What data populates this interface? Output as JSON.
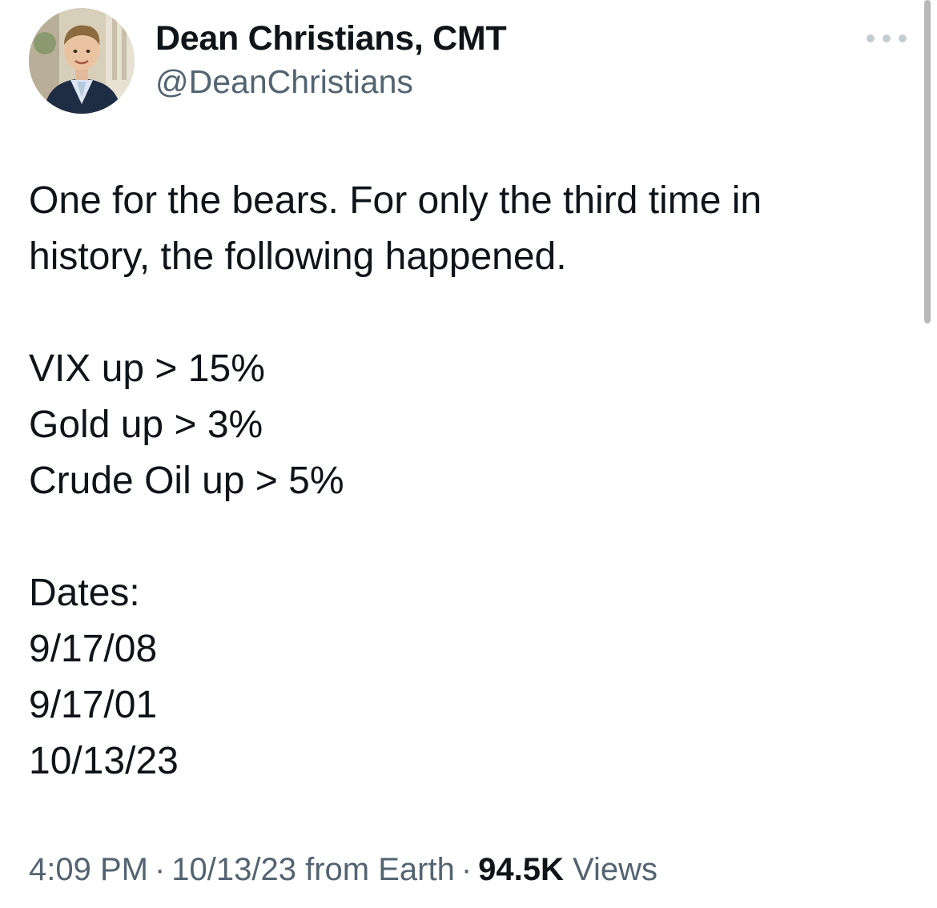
{
  "author": {
    "display_name": "Dean Christians, CMT",
    "handle": "@DeanChristians"
  },
  "more_menu": {
    "icon": "more-horizontal-icon"
  },
  "tweet": {
    "intro_lines": [
      "One for the bears. For only the third time in",
      "history, the following happened."
    ],
    "conditions": [
      "VIX up > 15%",
      "Gold up > 3%",
      "Crude Oil up > 5%"
    ],
    "dates_label": "Dates:",
    "dates": [
      "9/17/08",
      "9/17/01",
      "10/13/23"
    ]
  },
  "meta": {
    "time": "4:09 PM",
    "separator": "·",
    "date_source": "10/13/23 from Earth",
    "views_count": "94.5K",
    "views_label": "Views"
  },
  "colors": {
    "text_primary": "#0f1419",
    "text_secondary": "#536471",
    "more_dots": "#c6cdd2"
  }
}
